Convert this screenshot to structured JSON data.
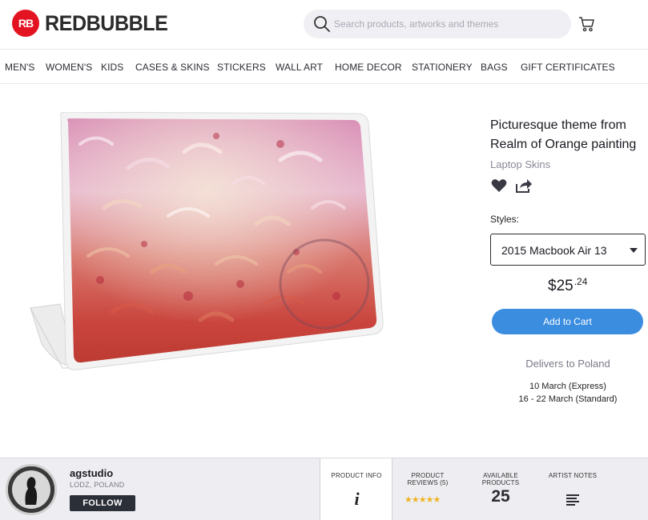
{
  "brand": {
    "name": "REDBUBBLE",
    "mark": "RB",
    "color": "#e41321"
  },
  "search": {
    "placeholder": "Search products, artworks and themes"
  },
  "nav": [
    "MEN'S",
    "WOMEN'S",
    "KIDS",
    "CASES & SKINS",
    "STICKERS",
    "WALL ART",
    "HOME DECOR",
    "STATIONERY",
    "BAGS",
    "GIFT CERTIFICATES"
  ],
  "product": {
    "title": "Picturesque theme from Realm of Orange painting",
    "category": "Laptop Skins",
    "styles_label": "Styles:",
    "style_selected": "2015 Macbook Air 13",
    "price_dollars": "$25",
    "price_cents": ".24",
    "add_to_cart": "Add to Cart",
    "delivers_to": "Delivers to Poland",
    "delivery_express": "10 March (Express)",
    "delivery_standard": "16 - 22 March (Standard)"
  },
  "artist": {
    "name": "agstudio",
    "location": "LODZ, POLAND",
    "follow": "FOLLOW",
    "product_info_label": "PRODUCT INFO",
    "product_info_icon": "i",
    "reviews_label": "PRODUCT REVIEWS (5)",
    "rating": 5,
    "stars": "★★★★★",
    "available_label": "AVAILABLE PRODUCTS",
    "available_count": "25",
    "notes_label": "ARTIST NOTES"
  },
  "colors": {
    "accent": "#3b8de0",
    "star": "#f0b325",
    "footer_bg": "#eeeef2"
  }
}
